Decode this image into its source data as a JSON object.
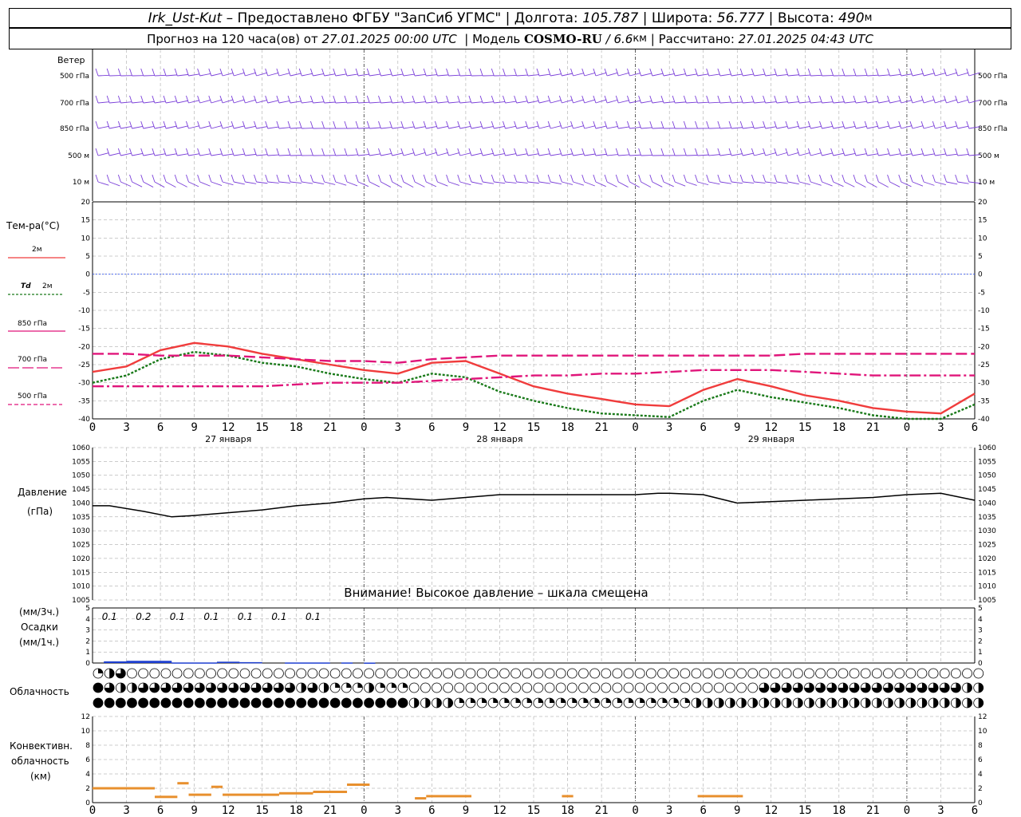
{
  "header": {
    "station": "Irk_Ust-Kut",
    "provider": " – Предоставлено ФГБУ \"ЗапСиб УГМС\" | Долгота: ",
    "lon": "105.787",
    "lat_label": " | Широта: ",
    "lat": "56.777",
    "alt_label": " | Высота: ",
    "alt": "490",
    "alt_unit": "м",
    "fc_prefix": "Прогноз на 120 часа(ов) от ",
    "fc_time": "27.01.2025 00:00 UTC",
    "model_label": "  | Модель ",
    "model": "COSMO-RU",
    "res": " / 6.6",
    "res_unit": "км",
    "calc_label": " | Рассчитано: ",
    "calc_time": "27.01.2025 04:43 UTC"
  },
  "colors": {
    "wind": "#7a3fd9",
    "t2m": "#f03c3c",
    "td2m": "#1a7a1a",
    "t850": "#e0157a",
    "t700": "#e0157a",
    "t500": "#e0157a",
    "pressure": "#000000",
    "precip": "#1e3fd0",
    "conv": "#e8902e",
    "grid": "#999999"
  },
  "labels": {
    "wind": "Ветер",
    "temp": "Тем-ра(°C)",
    "legend_t2m": "2м",
    "legend_td_sym": "Td",
    "legend_td": "2м",
    "legend_850": "850 гПа",
    "legend_700": "700 гПа",
    "legend_500": "500 гПа",
    "pressure1": "Давление",
    "pressure2": "(гПа)",
    "warning": "Внимание! Высокое давление – шкала смещена",
    "precip1": "(мм/3ч.)",
    "precip2": "Осадки",
    "precip3": "(мм/1ч.)",
    "cloud": "Облачность",
    "conv1": "Конвективн.",
    "conv2": "облачность",
    "conv3": "(км)"
  },
  "chart_data": [
    {
      "type": "wind-barbs",
      "levels": [
        "500 гПа",
        "700 гПа",
        "850 гПа",
        "500 м",
        "10 м"
      ]
    },
    {
      "type": "line",
      "x_hours": [
        0,
        3,
        6,
        9,
        12,
        15,
        18,
        21,
        24,
        27,
        30,
        33,
        36,
        39,
        42,
        45,
        48,
        51,
        54,
        57,
        60,
        63,
        66,
        69,
        72,
        75,
        78
      ],
      "x_tick_labels": [
        "0",
        "3",
        "6",
        "9",
        "12",
        "15",
        "18",
        "21",
        "0",
        "3",
        "6",
        "9",
        "12",
        "15",
        "18",
        "21",
        "0",
        "3",
        "6",
        "9",
        "12",
        "15",
        "18",
        "21",
        "0",
        "3",
        "6"
      ],
      "day_labels": [
        {
          "hour": 12,
          "text": "27 января"
        },
        {
          "hour": 36,
          "text": "28 января"
        },
        {
          "hour": 60,
          "text": "29 января"
        }
      ],
      "ylim": [
        -40,
        20
      ],
      "yticks": [
        -40,
        -35,
        -30,
        -25,
        -20,
        -15,
        -10,
        -5,
        0,
        5,
        10,
        15,
        20
      ],
      "series": [
        {
          "name": "2м",
          "key": "t2m",
          "values": [
            -27,
            -25.5,
            -21,
            -19,
            -20,
            -22,
            -23.5,
            -25,
            -26.5,
            -27.5,
            -24.5,
            -24,
            -27.5,
            -31,
            -33,
            -34.5,
            -36,
            -36.5,
            -32,
            -29,
            -31,
            -33.5,
            -35,
            -37,
            -38,
            -38.5,
            -33
          ]
        },
        {
          "name": "2м",
          "key": "td2m",
          "values": [
            -30,
            -28,
            -23.5,
            -21.5,
            -22.5,
            -24.5,
            -25.5,
            -27.5,
            -29,
            -30,
            -27.5,
            -28.5,
            -32.5,
            -35,
            -37,
            -38.5,
            -39,
            -39.5,
            -35,
            -32,
            -34,
            -35.5,
            -37,
            -39,
            -41,
            -42,
            -36
          ]
        },
        {
          "name": "850 гПа",
          "key": "t850",
          "values": [
            -22,
            -22,
            -22.5,
            -22.5,
            -22.5,
            -23,
            -23.5,
            -24,
            -24,
            -24.5,
            -23.5,
            -23,
            -22.5,
            -22.5,
            -22.5,
            -22.5,
            -22.5,
            -22.5,
            -22.5,
            -22.5,
            -22.5,
            -22,
            -22,
            -22,
            -22,
            -22,
            -22
          ]
        },
        {
          "name": "700 гПа",
          "key": "t700",
          "values": [
            -31,
            -31,
            -31,
            -31,
            -31,
            -31,
            -30.5,
            -30,
            -30,
            -30,
            -29.5,
            -29,
            -28.5,
            -28,
            -28,
            -27.5,
            -27.5,
            -27,
            -26.5,
            -26.5,
            -26.5,
            -27,
            -27.5,
            -28,
            -28,
            -28,
            -28
          ]
        }
      ]
    },
    {
      "type": "line",
      "ylim": [
        1005,
        1060
      ],
      "yticks": [
        1005,
        1010,
        1015,
        1020,
        1025,
        1030,
        1035,
        1040,
        1045,
        1050,
        1055,
        1060
      ],
      "series": [
        {
          "name": "Давление",
          "values": [
            1039,
            1039,
            1037,
            1035,
            1035.5,
            1036.5,
            1037.5,
            1039,
            1040,
            1041.5,
            1042,
            1041,
            1042,
            1043,
            1043,
            1043,
            1043,
            1043,
            1043.5,
            1043.5,
            1043,
            1040,
            1040.5,
            1041,
            1041.5,
            1042,
            1043,
            1043.5,
            1041
          ]
        },
        {
          "name": "x_hours",
          "values": [
            0,
            1.5,
            4.5,
            7,
            9,
            12,
            15,
            18,
            21,
            24,
            26,
            30,
            33,
            36,
            39,
            42,
            45,
            48,
            50,
            51,
            54,
            57,
            60,
            63,
            66,
            69,
            72,
            75,
            78
          ]
        }
      ]
    },
    {
      "type": "bar",
      "ylim": [
        0,
        5
      ],
      "yticks": [
        0,
        1,
        2,
        3,
        4,
        5
      ],
      "labels_3h": [
        {
          "hour": 1.5,
          "text": "0.1"
        },
        {
          "hour": 4.5,
          "text": "0.2"
        },
        {
          "hour": 7.5,
          "text": "0.1"
        },
        {
          "hour": 10.5,
          "text": "0.1"
        },
        {
          "hour": 13.5,
          "text": "0.1"
        },
        {
          "hour": 16.5,
          "text": "0.1"
        },
        {
          "hour": 19.5,
          "text": "0.1"
        }
      ],
      "bars_1h": [
        {
          "from": 1,
          "to": 3,
          "value": 0.15
        },
        {
          "from": 3,
          "to": 7,
          "value": 0.2
        },
        {
          "from": 7,
          "to": 11,
          "value": 0.05
        },
        {
          "from": 11,
          "to": 13,
          "value": 0.12
        },
        {
          "from": 13,
          "to": 15,
          "value": 0.08
        },
        {
          "from": 17,
          "to": 21,
          "value": 0.05
        },
        {
          "from": 22,
          "to": 23,
          "value": 0.05
        },
        {
          "from": 24,
          "to": 25,
          "value": 0.04
        }
      ]
    },
    {
      "type": "cloud-cover",
      "rows": [
        {
          "name": "high",
          "values": [
            1,
            2,
            3,
            0,
            0,
            0,
            0,
            0,
            0,
            0,
            0,
            0,
            0,
            0,
            0,
            0,
            0,
            0,
            0,
            0,
            0,
            0,
            0,
            0,
            0,
            0,
            0,
            0,
            0,
            0,
            0,
            0,
            0,
            0,
            0,
            0,
            0,
            0,
            0,
            0,
            0,
            0,
            0,
            0,
            0,
            0,
            0,
            0,
            0,
            0,
            0,
            0,
            0,
            0,
            0,
            0,
            0,
            0,
            0,
            0,
            0,
            0,
            0,
            0,
            0,
            0,
            0,
            0,
            0,
            0,
            0,
            0,
            0,
            0,
            0,
            0,
            0,
            0,
            0
          ]
        },
        {
          "name": "middle",
          "values": [
            4,
            3,
            2,
            2,
            3,
            3,
            3,
            3,
            3,
            3,
            3,
            3,
            3,
            3,
            3,
            3,
            3,
            3,
            2,
            3,
            2,
            1,
            1,
            1,
            2,
            1,
            1,
            1,
            0,
            0,
            0,
            0,
            0,
            0,
            0,
            0,
            0,
            0,
            0,
            0,
            0,
            0,
            0,
            0,
            0,
            0,
            0,
            0,
            0,
            0,
            0,
            0,
            0,
            0,
            0,
            0,
            0,
            0,
            0,
            3,
            3,
            3,
            3,
            3,
            3,
            3,
            3,
            3,
            3,
            3,
            3,
            3,
            3,
            3,
            3,
            3,
            3,
            2,
            2
          ]
        },
        {
          "name": "low",
          "values": [
            4,
            4,
            4,
            4,
            4,
            4,
            4,
            4,
            4,
            4,
            4,
            4,
            4,
            4,
            4,
            4,
            4,
            4,
            4,
            4,
            4,
            4,
            4,
            4,
            4,
            4,
            4,
            4,
            2,
            2,
            2,
            2,
            1,
            1,
            1,
            1,
            1,
            1,
            1,
            1,
            1,
            1,
            1,
            1,
            1,
            1,
            1,
            1,
            1,
            1,
            1,
            1,
            1,
            2,
            2,
            2,
            2,
            2,
            2,
            2,
            2,
            2,
            2,
            2,
            2,
            2,
            2,
            2,
            2,
            2,
            2,
            2,
            2,
            2,
            2,
            2,
            2,
            2,
            2
          ]
        }
      ]
    },
    {
      "type": "bar",
      "ylim": [
        0,
        12
      ],
      "yticks": [
        0,
        2,
        4,
        6,
        8,
        10,
        12
      ],
      "segments": [
        {
          "from": 0,
          "to": 5.5,
          "y": 2
        },
        {
          "from": 5.5,
          "to": 7.5,
          "y": 0.8
        },
        {
          "from": 7.5,
          "to": 8.5,
          "y": 2.7
        },
        {
          "from": 8.5,
          "to": 10.5,
          "y": 1.1
        },
        {
          "from": 10.5,
          "to": 11.5,
          "y": 2.2
        },
        {
          "from": 11.5,
          "to": 16.5,
          "y": 1.1
        },
        {
          "from": 16.5,
          "to": 19.5,
          "y": 1.3
        },
        {
          "from": 19.5,
          "to": 22.5,
          "y": 1.5
        },
        {
          "from": 22.5,
          "to": 24.5,
          "y": 2.5
        },
        {
          "from": 28.5,
          "to": 29.5,
          "y": 0.6
        },
        {
          "from": 29.5,
          "to": 33.5,
          "y": 0.9
        },
        {
          "from": 41.5,
          "to": 42.5,
          "y": 0.9
        },
        {
          "from": 53.5,
          "to": 57.5,
          "y": 0.9
        }
      ]
    }
  ]
}
